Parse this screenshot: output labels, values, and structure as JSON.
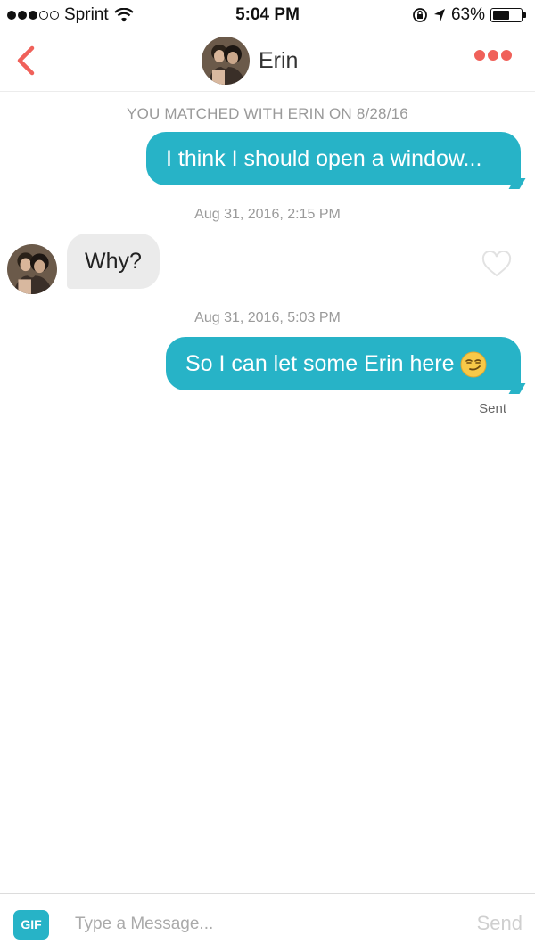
{
  "status_bar": {
    "carrier": "Sprint",
    "time": "5:04 PM",
    "battery_percent": "63%",
    "battery_level": 0.63,
    "signal_bars_filled": 3,
    "signal_bars_total": 5,
    "icons": [
      "wifi-icon",
      "rotation-lock-icon",
      "location-arrow-icon",
      "battery-icon"
    ]
  },
  "header": {
    "contact_name": "Erin",
    "back_icon": "chevron-left-icon",
    "menu_icon": "more-dots-icon",
    "accent_color": "#f0615a"
  },
  "conversation": {
    "match_banner": "YOU MATCHED WITH ERIN ON 8/28/16",
    "messages": [
      {
        "direction": "outgoing",
        "text": "I think I should open a window..."
      },
      {
        "timestamp": "Aug 31, 2016, 2:15 PM",
        "direction": "incoming",
        "text": "Why?"
      },
      {
        "timestamp": "Aug 31, 2016, 5:03 PM",
        "direction": "outgoing",
        "text": "So I can let some Erin here",
        "emoji": "smirking-face-emoji",
        "status": "Sent"
      }
    ],
    "outgoing_bubble_color": "#27b3c7",
    "incoming_bubble_color": "#ebebeb"
  },
  "composer": {
    "gif_label": "GIF",
    "placeholder": "Type a Message...",
    "value": "",
    "send_label": "Send"
  }
}
